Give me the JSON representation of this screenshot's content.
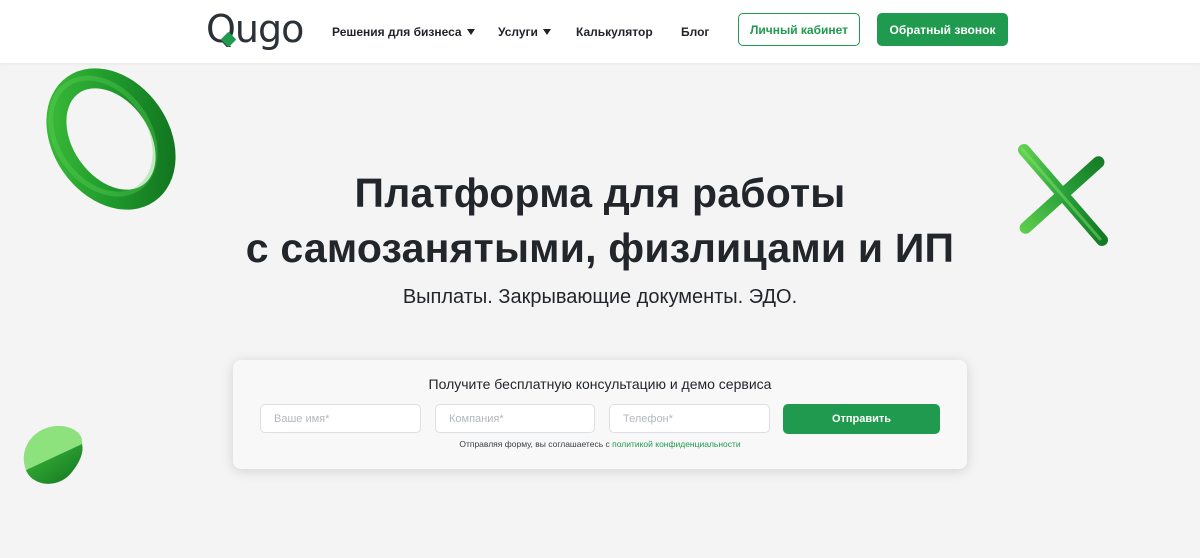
{
  "brand": {
    "logo_text": "Qugo",
    "accent_color": "#1f9a4e"
  },
  "nav": {
    "items": [
      {
        "label": "Решения для бизнеса",
        "has_dropdown": true
      },
      {
        "label": "Услуги",
        "has_dropdown": true
      },
      {
        "label": "Калькулятор",
        "has_dropdown": false
      },
      {
        "label": "Блог",
        "has_dropdown": false
      }
    ],
    "account_button": "Личный кабинет",
    "callback_button": "Обратный звонок"
  },
  "hero": {
    "title_line1": "Платформа для работы",
    "title_line2": "с самозанятыми, физлицами и ИП",
    "subtitle": "Выплаты. Закрывающие документы. ЭДО."
  },
  "form": {
    "title": "Получите бесплатную консультацию и демо сервиса",
    "name_placeholder": "Ваше имя*",
    "company_placeholder": "Компания*",
    "phone_placeholder": "Телефон*",
    "submit_label": "Отправить",
    "consent_text": "Отправляя форму, вы соглашаетесь с",
    "consent_link": "политикой конфиденциальности"
  },
  "icons": {
    "dropdown": "caret-down-icon",
    "decorations": [
      "green-torus",
      "green-cylinder",
      "green-half-sphere"
    ]
  }
}
